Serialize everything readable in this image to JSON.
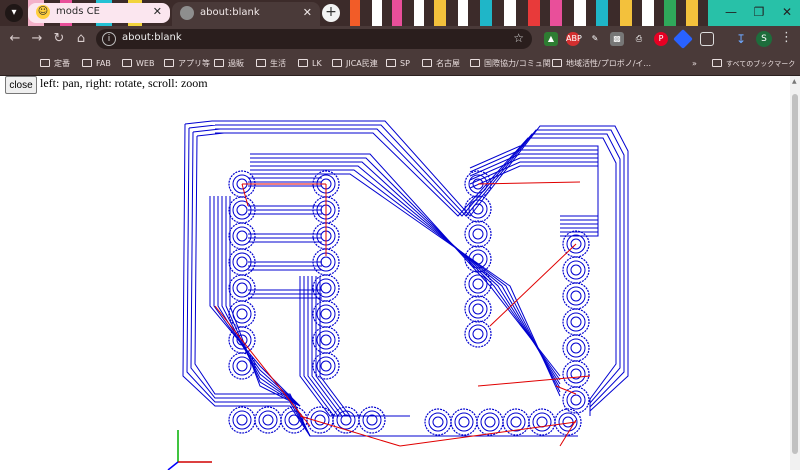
{
  "browser": {
    "tabs": [
      {
        "title": "mods CE",
        "favicon": "emoji-sunglasses-icon",
        "active": false
      },
      {
        "title": "about:blank",
        "favicon": "globe-icon",
        "active": true
      }
    ],
    "new_tab_label": "+",
    "url": "about:blank"
  },
  "bookmarks": [
    {
      "label": "定番"
    },
    {
      "label": "FAB"
    },
    {
      "label": "WEB"
    },
    {
      "label": "アプリ等"
    },
    {
      "label": "過販"
    },
    {
      "label": "生活"
    },
    {
      "label": "LK"
    },
    {
      "label": "JICA民連"
    },
    {
      "label": "SP"
    },
    {
      "label": "名古屋"
    },
    {
      "label": "国際協力/コミュ関"
    },
    {
      "label": "地域活性/プロボノ/イ..."
    }
  ],
  "bookmarks_more": "»",
  "all_bookmarks_label": "すべてのブックマーク",
  "profile_initial": "S",
  "page": {
    "close_label": "close",
    "hint": "left: pan, right: rotate, scroll: zoom"
  },
  "colors": {
    "toolpath": "#0000d0",
    "rapid": "#e00000",
    "axis_x": "#d00000",
    "axis_y": "#00b000",
    "axis_z": "#0000ff"
  }
}
